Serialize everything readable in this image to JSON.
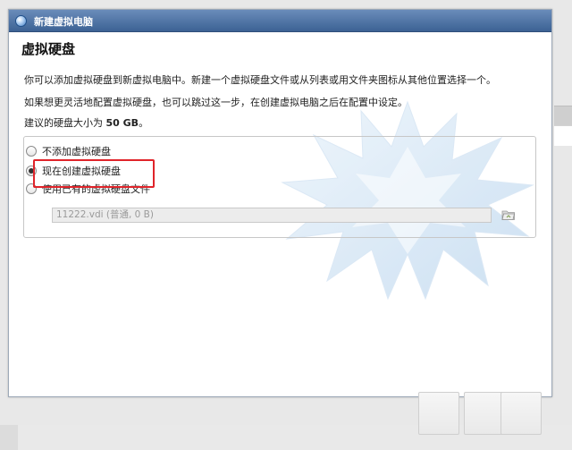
{
  "window": {
    "title": "新建虚拟电脑",
    "page_heading": "虚拟硬盘",
    "description_1": "你可以添加虚拟硬盘到新虚拟电脑中。新建一个虚拟硬盘文件或从列表或用文件夹图标从其他位置选择一个。",
    "description_2": "如果想更灵活地配置虚拟硬盘，也可以跳过这一步，在创建虚拟电脑之后在配置中设定。",
    "recommended_prefix": "建议的硬盘大小为",
    "recommended_size": "50 GB",
    "recommended_suffix": "。"
  },
  "disk_options": {
    "items": [
      {
        "label": "不添加虚拟硬盘",
        "checked": false
      },
      {
        "label": "现在创建虚拟硬盘",
        "checked": true
      },
      {
        "label": "使用已有的虚拟硬盘文件",
        "checked": false
      }
    ],
    "existing_file_value": "11222.vdi (普通, 0 B)"
  },
  "icons": {
    "title": "virtualbox-icon",
    "folder": "folder-open-icon"
  },
  "colors": {
    "titlebar": "#4a6fa5",
    "highlight": "#e0242a"
  }
}
